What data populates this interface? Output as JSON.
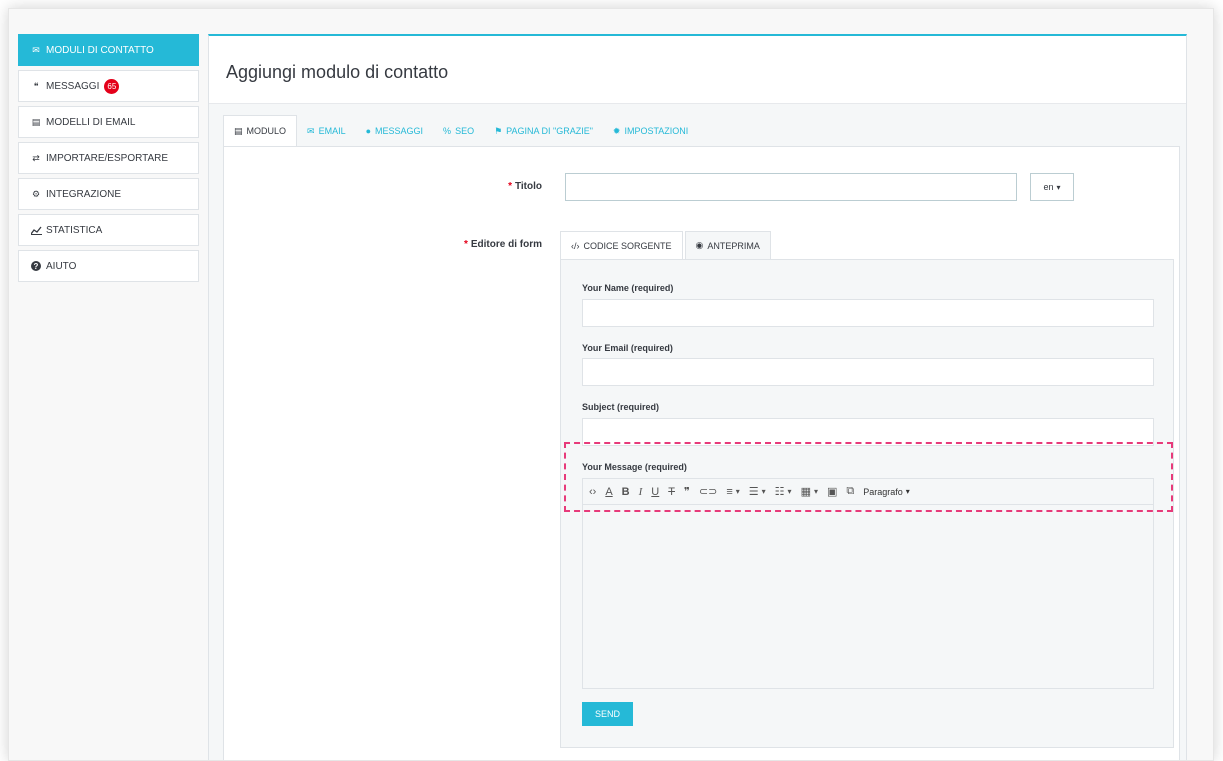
{
  "sidebar": {
    "items": [
      {
        "label": "MODULI DI CONTATTO",
        "icon": "envelope-icon",
        "glyph": "✉"
      },
      {
        "label": "MESSAGGI",
        "icon": "comments-icon",
        "glyph": "❝",
        "badge": "65"
      },
      {
        "label": "MODELLI DI EMAIL",
        "icon": "file-icon",
        "glyph": "▤"
      },
      {
        "label": "IMPORTARE/ESPORTARE",
        "icon": "exchange-icon",
        "glyph": "⇄"
      },
      {
        "label": "INTEGRAZIONE",
        "icon": "cogs-icon",
        "glyph": "⚙"
      },
      {
        "label": "STATISTICA",
        "icon": "line-chart-icon",
        "glyph": "📈"
      },
      {
        "label": "AIUTO",
        "icon": "question-circle-icon",
        "glyph": "?"
      }
    ]
  },
  "header": {
    "title": "Aggiungi modulo di contatto"
  },
  "tabs": [
    {
      "label": "MODULO",
      "icon": "list-alt-icon"
    },
    {
      "label": "EMAIL",
      "icon": "envelope-icon"
    },
    {
      "label": "MESSAGGI",
      "icon": "comments-icon"
    },
    {
      "label": "SEO",
      "icon": "link-icon"
    },
    {
      "label": "PAGINA DI \"GRAZIE\"",
      "icon": "flag-icon"
    },
    {
      "label": "IMPOSTAZIONI",
      "icon": "gear-icon"
    }
  ],
  "form": {
    "titolo_label": "Titolo",
    "titolo_value": "",
    "lang": "en",
    "editor_label": "Editore di form",
    "editor_tabs": [
      {
        "label": "CODICE SORGENTE",
        "icon": "code-icon"
      },
      {
        "label": "ANTEPRIMA",
        "icon": "eye-icon"
      }
    ]
  },
  "preview": {
    "fields": [
      {
        "label": "Your Name (required)"
      },
      {
        "label": "Your Email (required)"
      },
      {
        "label": "Subject (required)"
      },
      {
        "label": "Your Message (required)"
      }
    ],
    "paragraph_label": "Paragrafo",
    "send_label": "SEND"
  },
  "colors": {
    "accent": "#25b9d7",
    "badge": "#e4001a",
    "highlight": "#e73a7a"
  }
}
